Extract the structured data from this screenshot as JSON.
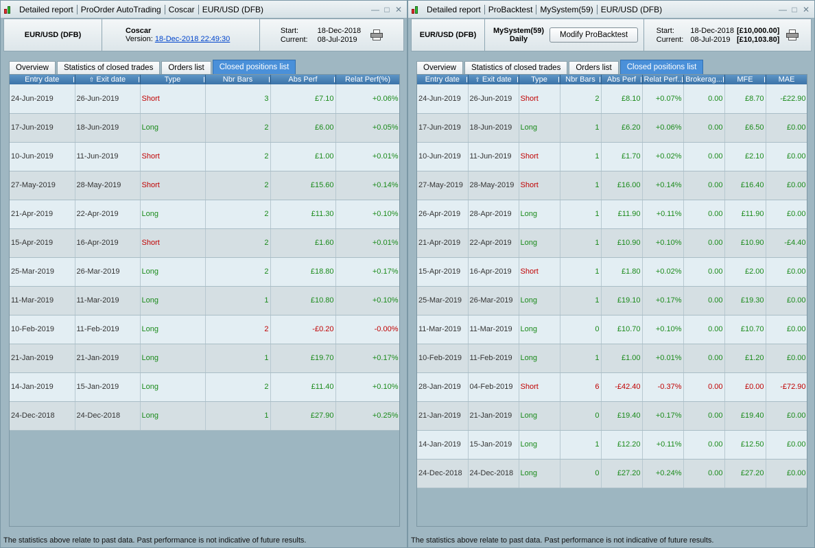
{
  "left": {
    "title_segments": [
      "Detailed report",
      "ProOrder AutoTrading",
      "Coscar",
      "EUR/USD (DFB)"
    ],
    "instrument": "EUR/USD (DFB)",
    "system_name": "Coscar",
    "version_label": "Version:",
    "version_value": "18-Dec-2018 22:49:30",
    "start_label": "Start:",
    "start_value": "18-Dec-2018",
    "current_label": "Current:",
    "current_value": "08-Jul-2019",
    "tabs": [
      "Overview",
      "Statistics of closed trades",
      "Orders list",
      "Closed positions list"
    ],
    "active_tab": 3,
    "columns": [
      "Entry date",
      "Exit date",
      "Type",
      "Nbr Bars",
      "Abs Perf",
      "Relat Perf(%)"
    ],
    "rows": [
      [
        "24-Jun-2019",
        "26-Jun-2019",
        "Short",
        "3",
        "£7.10",
        "+0.06%"
      ],
      [
        "17-Jun-2019",
        "18-Jun-2019",
        "Long",
        "2",
        "£6.00",
        "+0.05%"
      ],
      [
        "10-Jun-2019",
        "11-Jun-2019",
        "Short",
        "2",
        "£1.00",
        "+0.01%"
      ],
      [
        "27-May-2019",
        "28-May-2019",
        "Short",
        "2",
        "£15.60",
        "+0.14%"
      ],
      [
        "21-Apr-2019",
        "22-Apr-2019",
        "Long",
        "2",
        "£11.30",
        "+0.10%"
      ],
      [
        "15-Apr-2019",
        "16-Apr-2019",
        "Short",
        "2",
        "£1.60",
        "+0.01%"
      ],
      [
        "25-Mar-2019",
        "26-Mar-2019",
        "Long",
        "2",
        "£18.80",
        "+0.17%"
      ],
      [
        "11-Mar-2019",
        "11-Mar-2019",
        "Long",
        "1",
        "£10.80",
        "+0.10%"
      ],
      [
        "10-Feb-2019",
        "11-Feb-2019",
        "Long",
        "2",
        "-£0.20",
        "-0.00%"
      ],
      [
        "21-Jan-2019",
        "21-Jan-2019",
        "Long",
        "1",
        "£19.70",
        "+0.17%"
      ],
      [
        "14-Jan-2019",
        "15-Jan-2019",
        "Long",
        "2",
        "£11.40",
        "+0.10%"
      ],
      [
        "24-Dec-2018",
        "24-Dec-2018",
        "Long",
        "1",
        "£27.90",
        "+0.25%"
      ]
    ],
    "footer": "The statistics above relate to past data. Past performance is not indicative of future results."
  },
  "right": {
    "title_segments": [
      "Detailed report",
      "ProBacktest",
      "MySystem(59)",
      "EUR/USD (DFB)"
    ],
    "instrument": "EUR/USD (DFB)",
    "system_name": "MySystem(59)",
    "timeframe": "Daily",
    "modify_label": "Modify ProBacktest",
    "start_label": "Start:",
    "start_value": "18-Dec-2018",
    "start_capital": "[£10,000.00]",
    "current_label": "Current:",
    "current_value": "08-Jul-2019",
    "current_capital": "[£10,103.80]",
    "tabs": [
      "Overview",
      "Statistics of closed trades",
      "Orders list",
      "Closed positions list"
    ],
    "active_tab": 3,
    "columns": [
      "Entry date",
      "Exit date",
      "Type",
      "Nbr Bars",
      "Abs Perf",
      "Relat Perf...",
      "Brokerag...",
      "MFE",
      "MAE"
    ],
    "rows": [
      [
        "24-Jun-2019",
        "26-Jun-2019",
        "Short",
        "2",
        "£8.10",
        "+0.07%",
        "0.00",
        "£8.70",
        "-£22.90"
      ],
      [
        "17-Jun-2019",
        "18-Jun-2019",
        "Long",
        "1",
        "£6.20",
        "+0.06%",
        "0.00",
        "£6.50",
        "£0.00"
      ],
      [
        "10-Jun-2019",
        "11-Jun-2019",
        "Short",
        "1",
        "£1.70",
        "+0.02%",
        "0.00",
        "£2.10",
        "£0.00"
      ],
      [
        "27-May-2019",
        "28-May-2019",
        "Short",
        "1",
        "£16.00",
        "+0.14%",
        "0.00",
        "£16.40",
        "£0.00"
      ],
      [
        "26-Apr-2019",
        "28-Apr-2019",
        "Long",
        "1",
        "£11.90",
        "+0.11%",
        "0.00",
        "£11.90",
        "£0.00"
      ],
      [
        "21-Apr-2019",
        "22-Apr-2019",
        "Long",
        "1",
        "£10.90",
        "+0.10%",
        "0.00",
        "£10.90",
        "-£4.40"
      ],
      [
        "15-Apr-2019",
        "16-Apr-2019",
        "Short",
        "1",
        "£1.80",
        "+0.02%",
        "0.00",
        "£2.00",
        "£0.00"
      ],
      [
        "25-Mar-2019",
        "26-Mar-2019",
        "Long",
        "1",
        "£19.10",
        "+0.17%",
        "0.00",
        "£19.30",
        "£0.00"
      ],
      [
        "11-Mar-2019",
        "11-Mar-2019",
        "Long",
        "0",
        "£10.70",
        "+0.10%",
        "0.00",
        "£10.70",
        "£0.00"
      ],
      [
        "10-Feb-2019",
        "11-Feb-2019",
        "Long",
        "1",
        "£1.00",
        "+0.01%",
        "0.00",
        "£1.20",
        "£0.00"
      ],
      [
        "28-Jan-2019",
        "04-Feb-2019",
        "Short",
        "6",
        "-£42.40",
        "-0.37%",
        "0.00",
        "£0.00",
        "-£72.90"
      ],
      [
        "21-Jan-2019",
        "21-Jan-2019",
        "Long",
        "0",
        "£19.40",
        "+0.17%",
        "0.00",
        "£19.40",
        "£0.00"
      ],
      [
        "14-Jan-2019",
        "15-Jan-2019",
        "Long",
        "1",
        "£12.20",
        "+0.11%",
        "0.00",
        "£12.50",
        "£0.00"
      ],
      [
        "24-Dec-2018",
        "24-Dec-2018",
        "Long",
        "0",
        "£27.20",
        "+0.24%",
        "0.00",
        "£27.20",
        "£0.00"
      ]
    ],
    "footer": "The statistics above relate to past data. Past performance is not indicative of future results."
  },
  "colors": {
    "profit": "#1a8a1a",
    "loss": "#c00000",
    "short": "#c00000",
    "long": "#1a8a1a",
    "active_tab": "#4a90d9",
    "header_blue": "#3b73a8"
  },
  "icons": [
    "app-chart-icon",
    "printer-icon",
    "minimize-icon",
    "maximize-icon",
    "close-icon",
    "sort-up-icon"
  ]
}
